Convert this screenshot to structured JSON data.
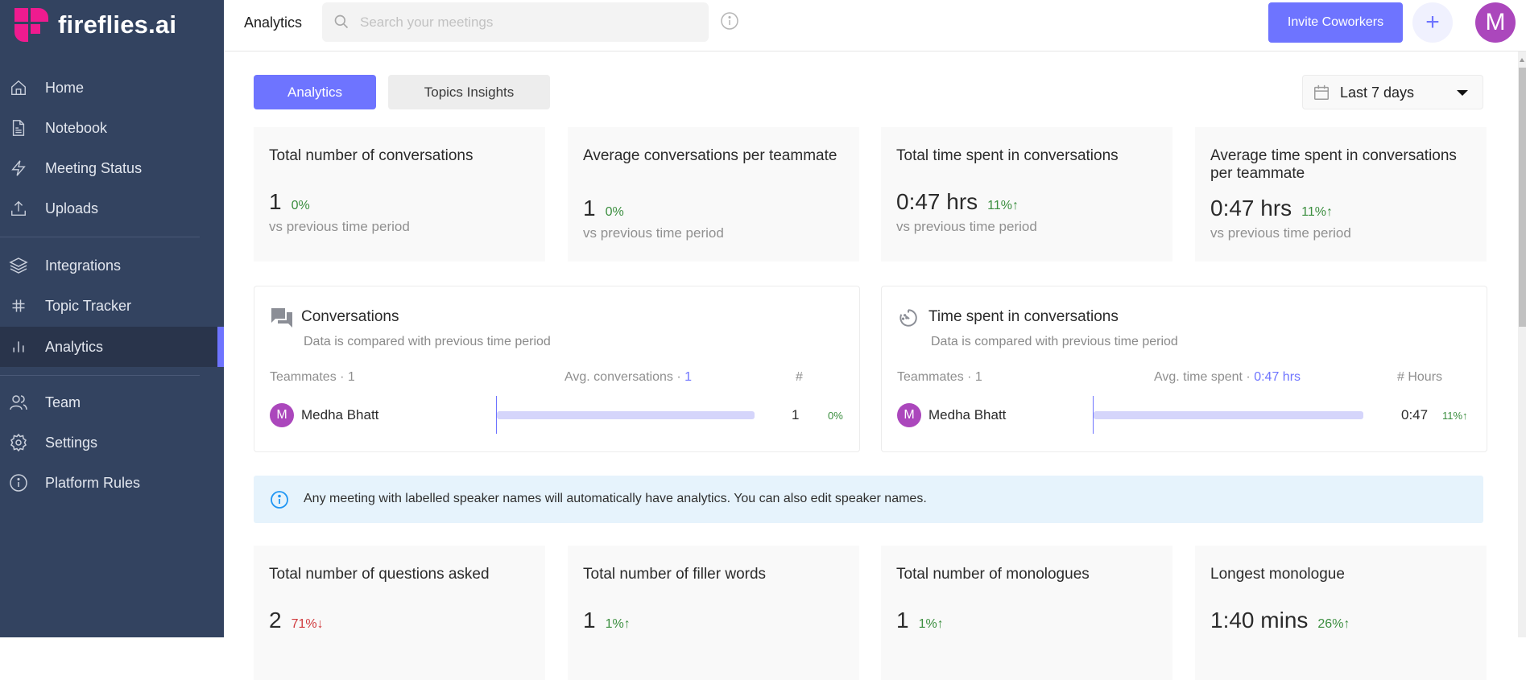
{
  "app": {
    "logo_text": "fireflies.ai",
    "brand_color": "#ef1b8f",
    "accent_color": "#6e74ff"
  },
  "sidebar": {
    "items": [
      {
        "label": "Home",
        "icon": "home-icon"
      },
      {
        "label": "Notebook",
        "icon": "notebook-icon"
      },
      {
        "label": "Meeting Status",
        "icon": "lightning-icon"
      },
      {
        "label": "Uploads",
        "icon": "upload-icon"
      },
      {
        "label": "Integrations",
        "icon": "layers-icon"
      },
      {
        "label": "Topic Tracker",
        "icon": "hash-icon"
      },
      {
        "label": "Analytics",
        "icon": "bar-chart-icon",
        "active": true
      },
      {
        "label": "Team",
        "icon": "team-icon"
      },
      {
        "label": "Settings",
        "icon": "gear-icon"
      },
      {
        "label": "Platform Rules",
        "icon": "info-icon"
      }
    ]
  },
  "header": {
    "title": "Analytics",
    "search_placeholder": "Search your meetings",
    "invite_label": "Invite Coworkers",
    "plus_label": "+",
    "avatar_initial": "M"
  },
  "tabs": [
    {
      "label": "Analytics",
      "active": true
    },
    {
      "label": "Topics Insights",
      "active": false
    }
  ],
  "date_filter": {
    "value": "Last 7 days"
  },
  "stats_top": [
    {
      "title": "Total number of conversations",
      "value": "1",
      "change": "0%",
      "direction": "none",
      "sub": "vs previous time period"
    },
    {
      "title": "Average conversations per teammate",
      "value": "1",
      "change": "0%",
      "direction": "none",
      "sub": "vs previous time period"
    },
    {
      "title": "Total time spent in conversations",
      "value": "0:47 hrs",
      "change": "11%↑",
      "direction": "up",
      "sub": "vs previous time period"
    },
    {
      "title": "Average time spent in conversations per teammate",
      "value": "0:47 hrs",
      "change": "11%↑",
      "direction": "up",
      "sub": "vs previous time period"
    }
  ],
  "panels": {
    "conversations": {
      "title": "Conversations",
      "subtitle": "Data is compared with previous time period",
      "teammates_label": "Teammates · 1",
      "avg_label": "Avg. conversations · ",
      "avg_value": "1",
      "count_header": "#",
      "rows": [
        {
          "initial": "M",
          "name": "Medha Bhatt",
          "value": "1",
          "change": "0%",
          "bar_fraction": 1.0
        }
      ]
    },
    "time_spent": {
      "title": "Time spent in conversations",
      "subtitle": "Data is compared with previous time period",
      "teammates_label": "Teammates · 1",
      "avg_label": "Avg. time spent · ",
      "avg_value": "0:47 hrs",
      "count_header": "# Hours",
      "rows": [
        {
          "initial": "M",
          "name": "Medha Bhatt",
          "value": "0:47",
          "change": "11%↑",
          "bar_fraction": 1.0
        }
      ]
    }
  },
  "banner": {
    "text": "Any meeting with labelled speaker names will automatically have analytics. You can also edit speaker names."
  },
  "stats_bottom": [
    {
      "title": "Total number of questions asked",
      "value": "2",
      "change": "71%↓",
      "direction": "down"
    },
    {
      "title": "Total number of filler words",
      "value": "1",
      "change": "1%↑",
      "direction": "up"
    },
    {
      "title": "Total number of monologues",
      "value": "1",
      "change": "1%↑",
      "direction": "up"
    },
    {
      "title": "Longest monologue",
      "value": "1:40 mins",
      "change": "26%↑",
      "direction": "up"
    }
  ]
}
